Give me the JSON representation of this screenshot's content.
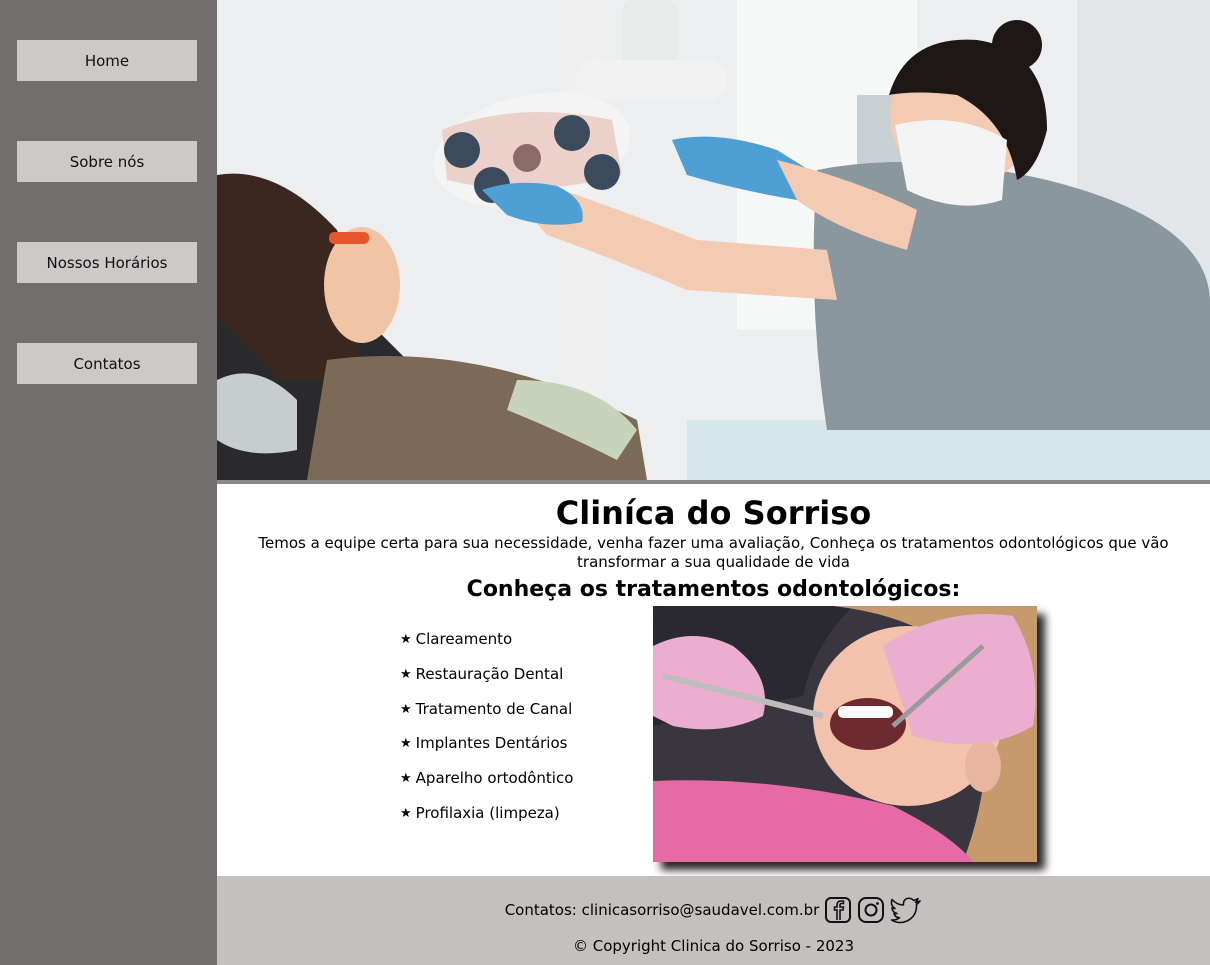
{
  "nav": {
    "items": [
      {
        "label": "Home"
      },
      {
        "label": "Sobre nós"
      },
      {
        "label": "Nossos Horários"
      },
      {
        "label": "Contatos"
      }
    ]
  },
  "main": {
    "title": "Cliníca do Sorriso",
    "subtitle": "Temos a equipe certa para sua necessidade, venha fazer uma avaliação, Conheça os tratamentos odontológicos que vão transformar a sua qualidade de vida",
    "treatments_heading": "Conheça os tratamentos odontológicos:",
    "treatments": [
      "Clareamento",
      "Restauração Dental",
      "Tratamento de Canal",
      "Implantes Dentários",
      "Aparelho ortodôntico",
      "Profilaxia (limpeza)"
    ],
    "bullet_icon": "star-icon"
  },
  "footer": {
    "contacts_text": "Contatos: clinicasorriso@saudavel.com.br",
    "social_icons": [
      "facebook-icon",
      "instagram-icon",
      "twitter-icon"
    ],
    "copyright": "© Copyright Clinica do Sorriso - 2023"
  },
  "colors": {
    "sidebar_bg": "#736e6e",
    "nav_button_bg": "#cdc9c9",
    "footer_bg": "#c4c0c0"
  }
}
